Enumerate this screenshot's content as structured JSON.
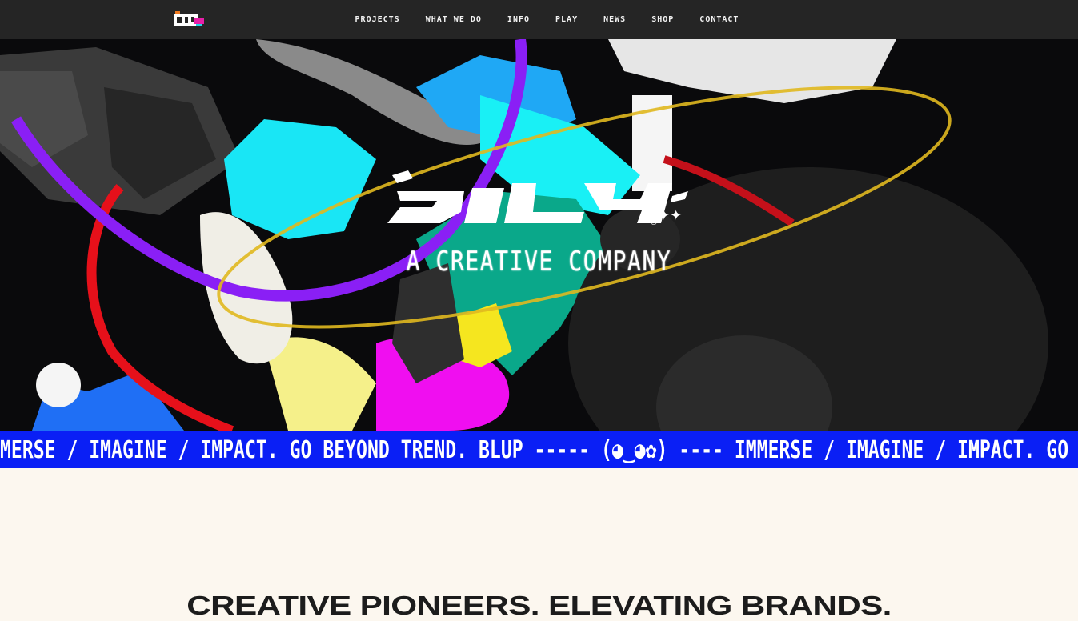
{
  "nav": {
    "logo_text": "blup",
    "links": [
      {
        "label": "PROJECTS"
      },
      {
        "label": "WHAT WE DO"
      },
      {
        "label": "INFO"
      },
      {
        "label": "PLAY"
      },
      {
        "label": "NEWS"
      },
      {
        "label": "SHOP"
      },
      {
        "label": "CONTACT"
      }
    ]
  },
  "hero": {
    "brand_logo_text": "blup",
    "tagline": "A CREATIVE COMPANY"
  },
  "ticker": {
    "text": "MERSE / IMAGINE / IMPACT. GO BEYOND TREND. BLUP ----- (◕‿◕✿) ---- IMMERSE / IMAGINE / IMPACT. GO BEYOND TREND. BLUP"
  },
  "section": {
    "headline": "CREATIVE PIONEERS. ELEVATING BRANDS."
  },
  "colors": {
    "nav_bg": "#252525",
    "ticker_bg": "#0a1ff5",
    "page_bg": "#fcf7ef",
    "accent_cyan": "#19e6f5",
    "accent_magenta": "#f00ef0",
    "accent_purple": "#8a1ff5"
  }
}
